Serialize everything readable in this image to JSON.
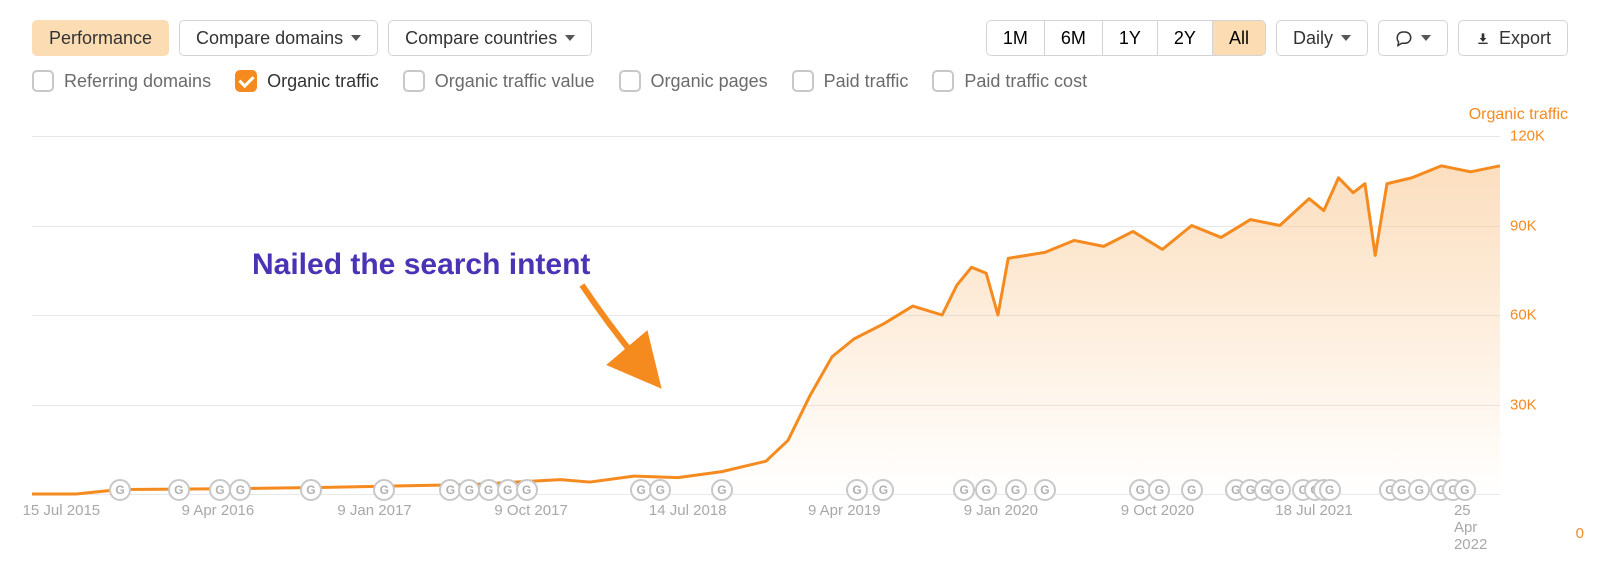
{
  "toolbar": {
    "performance": "Performance",
    "compare_domains": "Compare domains",
    "compare_countries": "Compare countries",
    "ranges": [
      "1M",
      "6M",
      "1Y",
      "2Y",
      "All"
    ],
    "range_active_index": 4,
    "granularity": "Daily",
    "export": "Export"
  },
  "metrics": [
    {
      "label": "Referring domains",
      "checked": false
    },
    {
      "label": "Organic traffic",
      "checked": true
    },
    {
      "label": "Organic traffic value",
      "checked": false
    },
    {
      "label": "Organic pages",
      "checked": false
    },
    {
      "label": "Paid traffic",
      "checked": false
    },
    {
      "label": "Paid traffic cost",
      "checked": false
    }
  ],
  "legend": "Organic traffic",
  "annotation": "Nailed the search intent",
  "chart_data": {
    "type": "area",
    "title": "",
    "xlabel": "",
    "ylabel": "Organic traffic",
    "ylim": [
      0,
      120000
    ],
    "y_ticks": [
      30000,
      60000,
      90000,
      120000
    ],
    "y_tick_labels": [
      "30K",
      "60K",
      "90K",
      "120K"
    ],
    "x_tick_labels": [
      "15 Jul 2015",
      "9 Apr 2016",
      "9 Jan 2017",
      "9 Oct 2017",
      "14 Jul 2018",
      "9 Apr 2019",
      "9 Jan 2020",
      "9 Oct 2020",
      "18 Jul 2021",
      "25 Apr 2022"
    ],
    "series": [
      {
        "name": "Organic traffic",
        "color": "#f58a1f",
        "points": [
          {
            "x_pct": 0,
            "y": 0
          },
          {
            "x_pct": 3,
            "y": 0
          },
          {
            "x_pct": 6,
            "y": 1500
          },
          {
            "x_pct": 14,
            "y": 1800
          },
          {
            "x_pct": 20,
            "y": 2200
          },
          {
            "x_pct": 30,
            "y": 3200
          },
          {
            "x_pct": 36,
            "y": 4800
          },
          {
            "x_pct": 38,
            "y": 4000
          },
          {
            "x_pct": 41,
            "y": 6000
          },
          {
            "x_pct": 44,
            "y": 5500
          },
          {
            "x_pct": 47,
            "y": 7500
          },
          {
            "x_pct": 50,
            "y": 11000
          },
          {
            "x_pct": 51.5,
            "y": 18000
          },
          {
            "x_pct": 53,
            "y": 33000
          },
          {
            "x_pct": 54.5,
            "y": 46000
          },
          {
            "x_pct": 56,
            "y": 52000
          },
          {
            "x_pct": 58,
            "y": 57000
          },
          {
            "x_pct": 60,
            "y": 63000
          },
          {
            "x_pct": 62,
            "y": 60000
          },
          {
            "x_pct": 63,
            "y": 70000
          },
          {
            "x_pct": 64,
            "y": 76000
          },
          {
            "x_pct": 65,
            "y": 74000
          },
          {
            "x_pct": 65.8,
            "y": 60000
          },
          {
            "x_pct": 66.5,
            "y": 79000
          },
          {
            "x_pct": 69,
            "y": 81000
          },
          {
            "x_pct": 71,
            "y": 85000
          },
          {
            "x_pct": 73,
            "y": 83000
          },
          {
            "x_pct": 75,
            "y": 88000
          },
          {
            "x_pct": 77,
            "y": 82000
          },
          {
            "x_pct": 79,
            "y": 90000
          },
          {
            "x_pct": 81,
            "y": 86000
          },
          {
            "x_pct": 83,
            "y": 92000
          },
          {
            "x_pct": 85,
            "y": 90000
          },
          {
            "x_pct": 87,
            "y": 99000
          },
          {
            "x_pct": 88,
            "y": 95000
          },
          {
            "x_pct": 89,
            "y": 106000
          },
          {
            "x_pct": 90,
            "y": 101000
          },
          {
            "x_pct": 90.8,
            "y": 104000
          },
          {
            "x_pct": 91.5,
            "y": 80000
          },
          {
            "x_pct": 92.3,
            "y": 104000
          },
          {
            "x_pct": 94,
            "y": 106000
          },
          {
            "x_pct": 96,
            "y": 110000
          },
          {
            "x_pct": 98,
            "y": 108000
          },
          {
            "x_pct": 100,
            "y": 110000
          }
        ]
      }
    ],
    "g_markers_pct": [
      6,
      10,
      12.8,
      14.2,
      19,
      24,
      28.5,
      29.8,
      31.1,
      32.4,
      33.7,
      41.5,
      42.8,
      47,
      56.2,
      58,
      63.5,
      65,
      67,
      69,
      75.5,
      76.8,
      79,
      82,
      83,
      84,
      85,
      86.6,
      87.4,
      88,
      88.4,
      92.5,
      93.3,
      94.5,
      96,
      96.8,
      97.6
    ]
  }
}
